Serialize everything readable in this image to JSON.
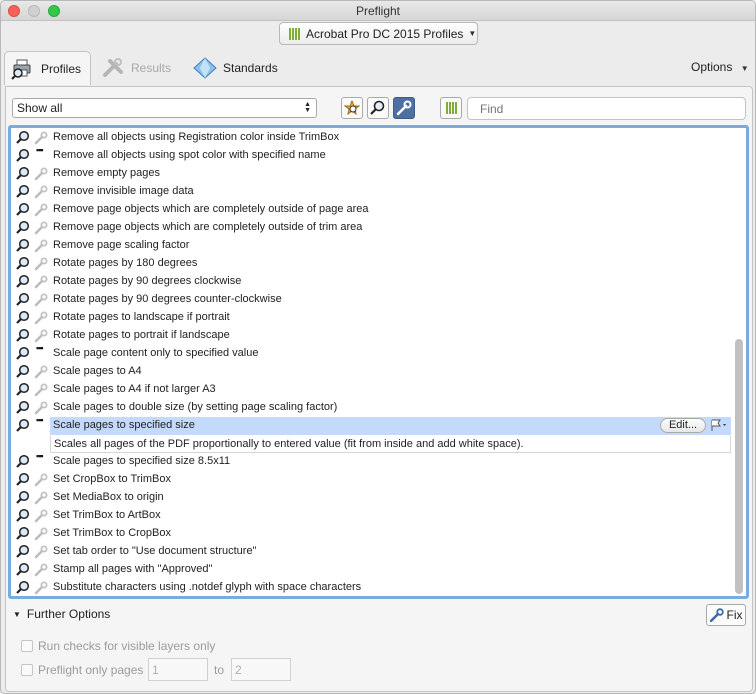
{
  "window": {
    "title": "Preflight"
  },
  "profile_selector": {
    "label": "Acrobat Pro DC 2015 Profiles"
  },
  "tabs": {
    "profiles": "Profiles",
    "results": "Results",
    "standards": "Standards"
  },
  "options": {
    "label": "Options"
  },
  "filter": {
    "value": "Show all"
  },
  "find": {
    "placeholder": "Find"
  },
  "rows": [
    {
      "label": "Remove all objects using Registration color inside TrimBox",
      "dots": false
    },
    {
      "label": "Remove all objects using spot color with specified name",
      "dots": true
    },
    {
      "label": "Remove empty pages",
      "dots": false
    },
    {
      "label": "Remove invisible image data",
      "dots": false
    },
    {
      "label": "Remove page objects which are completely outside of page area",
      "dots": false
    },
    {
      "label": "Remove page objects which are completely outside of trim area",
      "dots": false
    },
    {
      "label": "Remove page scaling factor",
      "dots": false
    },
    {
      "label": "Rotate pages by 180 degrees",
      "dots": false
    },
    {
      "label": "Rotate pages by 90 degrees clockwise",
      "dots": false
    },
    {
      "label": "Rotate pages by 90 degrees counter-clockwise",
      "dots": false
    },
    {
      "label": "Rotate pages to landscape if portrait",
      "dots": false
    },
    {
      "label": "Rotate pages to portrait if landscape",
      "dots": false
    },
    {
      "label": "Scale page content only to specified value",
      "dots": true
    },
    {
      "label": "Scale pages to A4",
      "dots": false
    },
    {
      "label": "Scale pages to A4 if not larger A3",
      "dots": false
    },
    {
      "label": "Scale pages to double size (by setting page scaling factor)",
      "dots": false
    },
    {
      "label": "Scale pages to specified size",
      "dots": true,
      "selected": true
    },
    {
      "label": "Scale pages to specified size 8.5x11",
      "dots": true
    },
    {
      "label": "Set CropBox to TrimBox",
      "dots": false
    },
    {
      "label": "Set MediaBox to origin",
      "dots": false
    },
    {
      "label": "Set TrimBox to ArtBox",
      "dots": false
    },
    {
      "label": "Set TrimBox to CropBox",
      "dots": false
    },
    {
      "label": "Set tab order to \"Use document structure\"",
      "dots": false
    },
    {
      "label": "Stamp all pages with \"Approved\"",
      "dots": false
    },
    {
      "label": "Substitute characters using .notdef glyph with space characters",
      "dots": false
    }
  ],
  "selected": {
    "edit_label": "Edit...",
    "description": "Scales all pages of the PDF proportionally to entered value (fit from inside and add white space)."
  },
  "further": {
    "label": "Further Options",
    "fix_label": "Fix",
    "visible_layers_label": "Run checks for visible layers only",
    "pages_label": "Preflight only pages",
    "from_value": "1",
    "to_label": "to",
    "to_value": "2"
  },
  "colors": {
    "accent": "#7aabdf",
    "selection": "#c3dafd",
    "profile_bars": "#7bb034"
  }
}
